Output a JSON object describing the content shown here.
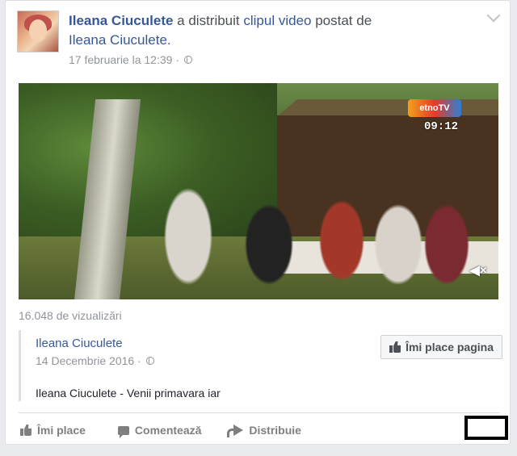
{
  "post": {
    "author": "Ileana Ciuculete",
    "action_text": " a distribuit ",
    "clip_link": "clipul video",
    "posted_by_text": " postat de ",
    "original_author": "Ileana Ciuculete.",
    "timestamp": "17 februarie la 12:39 ·"
  },
  "video": {
    "channel_logo": "etnoTV",
    "clock": "09:12",
    "mute_label": "◀×",
    "views": "16.048 de vizualizări"
  },
  "shared": {
    "page_name": "Ileana Ciuculete",
    "date": "14 Decembrie 2016 ·",
    "like_page_label": "Îmi place pagina",
    "description": "Ileana Ciuculete - Venii primavara iar"
  },
  "actions": {
    "like": "Îmi place",
    "comment": "Comentează",
    "share": "Distribuie"
  },
  "colors": {
    "link": "#365899",
    "muted": "#90949c",
    "background": "#e9ebee"
  }
}
